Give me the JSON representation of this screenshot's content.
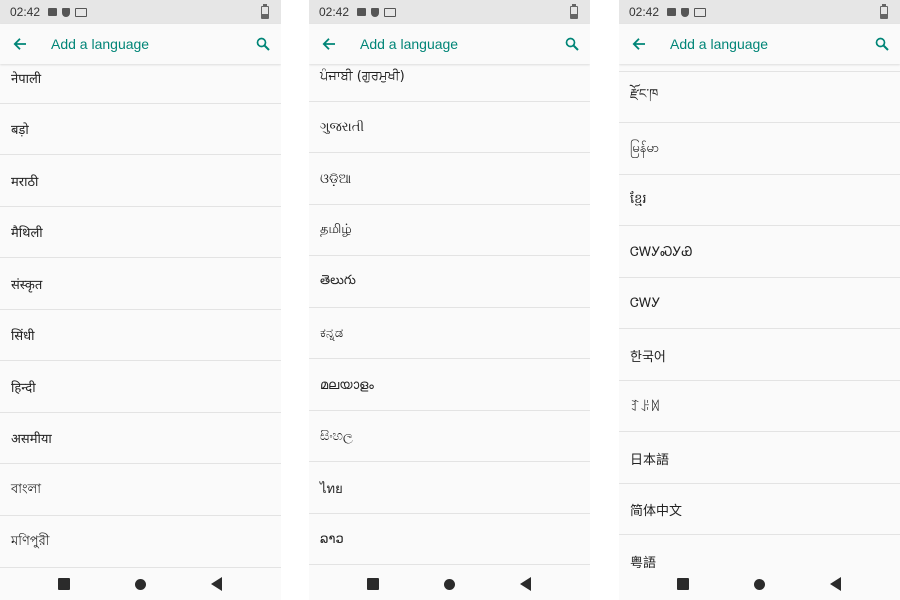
{
  "status_bar": {
    "time": "02:42"
  },
  "app_bar": {
    "title": "Add a language"
  },
  "colors": {
    "accent": "#008577",
    "status_bar": "#e6e6e6",
    "background": "#fafafa",
    "divider": "#e3e3e3"
  },
  "icons": {
    "back": "arrow-left-icon",
    "search": "search-icon",
    "nav_back": "triangle-back-icon",
    "nav_home": "circle-home-icon",
    "nav_recent": "square-recents-icon"
  },
  "screens": [
    {
      "languages": [
        "नेपाली",
        "बड़ो",
        "मराठी",
        "मैथिली",
        "संस्कृत",
        "सिंधी",
        "हिन्दी",
        "असमीया",
        "বাংলা",
        "মণিপুরী"
      ]
    },
    {
      "languages": [
        "ਪੰਜਾਬੀ (ਗੁਰਮੁਖੀ)",
        "ગુજરાતી",
        "ଓଡ଼ିଆ",
        "தமிழ்",
        "తెలుగు",
        "ಕನ್ನಡ",
        "മലയാളം",
        "සිංහල",
        "ไทย",
        "ລາວ"
      ]
    },
    {
      "languages": [
        "རྫོང་ཁ",
        "မြန်မာ",
        "ខ្មែរ",
        "ᏣᎳᎩᏍᎩᏯ",
        "ᏣᎳᎩ",
        "한국어",
        "ꆈꌠꉙ",
        "日本語",
        "简体中文",
        "粤語"
      ]
    }
  ]
}
